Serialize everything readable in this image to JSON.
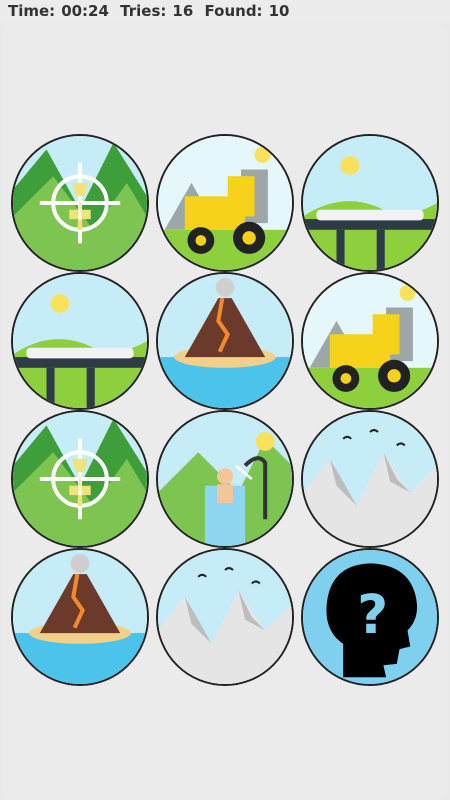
{
  "status": {
    "time_label": "Time:",
    "time_value": "00:24",
    "tries_label": "Tries:",
    "tries_value": "16",
    "found_label": "Found:",
    "found_value": "10"
  },
  "cards": [
    {
      "scene": "deer-target"
    },
    {
      "scene": "tractor"
    },
    {
      "scene": "train-bridge"
    },
    {
      "scene": "train-bridge"
    },
    {
      "scene": "volcano"
    },
    {
      "scene": "tractor"
    },
    {
      "scene": "deer-target"
    },
    {
      "scene": "shower"
    },
    {
      "scene": "mountains"
    },
    {
      "scene": "volcano"
    },
    {
      "scene": "mountains"
    },
    {
      "scene": "hidden-question"
    }
  ],
  "colors": {
    "sky": "#c5ecf7",
    "grass": "#7dc451",
    "tractor": "#f6d21a",
    "water": "#4cc3ea",
    "hidden_bg": "#7fd0ee"
  }
}
